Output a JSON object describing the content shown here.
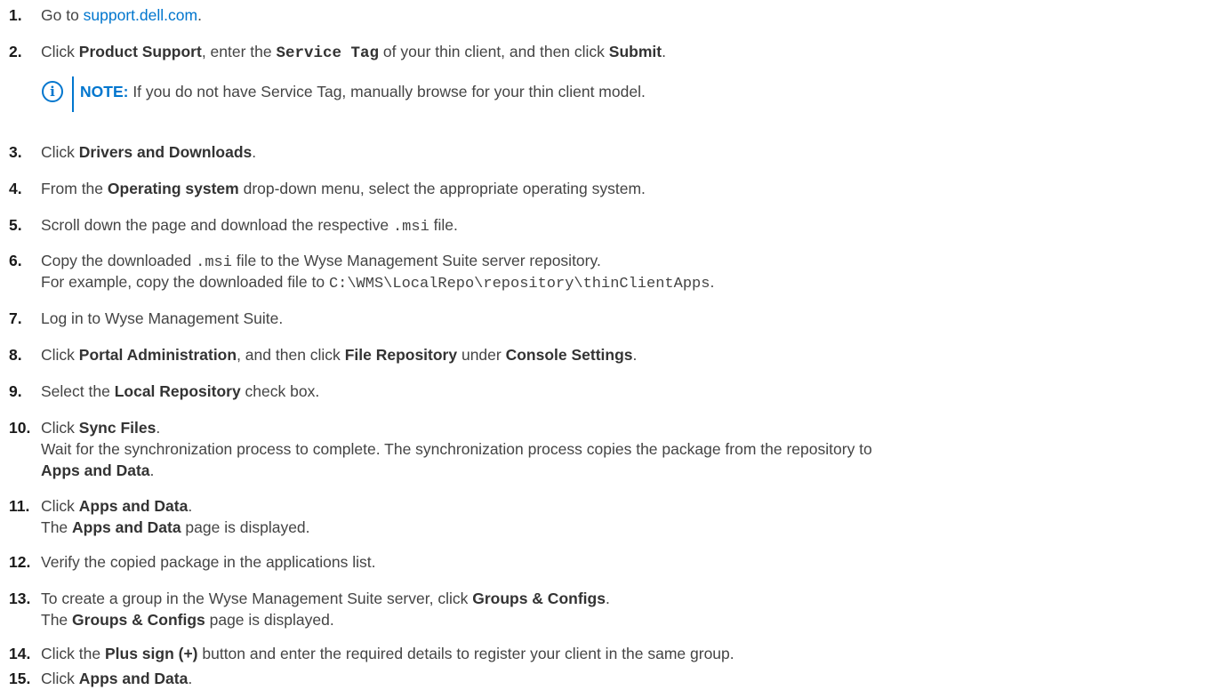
{
  "steps": [
    {
      "num": "1.",
      "pre": "Go to ",
      "link": "support.dell.com",
      "post": "."
    },
    {
      "num": "2.",
      "pre": "Click ",
      "b1": "Product Support",
      "mid1": ", enter the ",
      "code": "Service Tag",
      "mid2": " of your thin client, and then click ",
      "b2": "Submit",
      "post": "."
    },
    {
      "num": "3.",
      "pre": "Click ",
      "b1": "Drivers and Downloads",
      "post": "."
    },
    {
      "num": "4.",
      "pre": "From the ",
      "b1": "Operating system",
      "post": " drop-down menu, select the appropriate operating system."
    },
    {
      "num": "5.",
      "pre": "Scroll down the page and download the respective ",
      "code": ".msi",
      "post": " file."
    },
    {
      "num": "6.",
      "pre": "Copy the downloaded ",
      "code": ".msi",
      "post": " file to the Wyse Management Suite server repository.",
      "l2pre": "For example, copy the downloaded file to ",
      "l2code": "C:\\WMS\\LocalRepo\\repository\\thinClientApps",
      "l2post": "."
    },
    {
      "num": "7.",
      "pre": "Log in to Wyse Management Suite."
    },
    {
      "num": "8.",
      "pre": "Click ",
      "b1": "Portal Administration",
      "mid1": ", and then click ",
      "b2": "File Repository",
      "mid2": " under ",
      "b3": "Console Settings",
      "post": "."
    },
    {
      "num": "9.",
      "pre": "Select the ",
      "b1": "Local Repository",
      "post": " check box."
    },
    {
      "num": "10.",
      "pre": "Click ",
      "b1": "Sync Files",
      "post": ".",
      "l2pre": "Wait for the synchronization process to complete. The synchronization process copies the package from the repository to",
      "l3b": "Apps and Data",
      "l3post": "."
    },
    {
      "num": "11.",
      "pre": "Click ",
      "b1": "Apps and Data",
      "post": ".",
      "l2pre": "The ",
      "l2b": "Apps and Data",
      "l2post": " page is displayed."
    },
    {
      "num": "12.",
      "pre": "Verify the copied package in the applications list."
    },
    {
      "num": "13.",
      "pre": "To create a group in the Wyse Management Suite server, click ",
      "b1": "Groups & Configs",
      "post": ".",
      "l2pre": "The ",
      "l2b": "Groups & Configs",
      "l2post": " page is displayed."
    },
    {
      "num": "14.",
      "pre": "Click the ",
      "b1": "Plus sign (+)",
      "post": " button and enter the required details to register your client in the same group."
    },
    {
      "num": "15.",
      "pre": "Click ",
      "b1": "Apps and Data",
      "post": "."
    }
  ],
  "note": {
    "icon": "info-circle-icon",
    "label": "NOTE:",
    "text": " If you do not have Service Tag, manually browse for your thin client model."
  },
  "colors": {
    "accent": "#0076ce",
    "text": "#444444"
  }
}
